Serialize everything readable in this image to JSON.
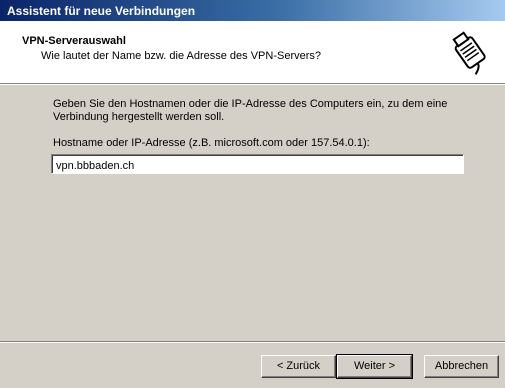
{
  "window": {
    "title": "Assistent für neue Verbindungen"
  },
  "header": {
    "title": "VPN-Serverauswahl",
    "subtitle": "Wie lautet der Name bzw. die Adresse des VPN-Servers?",
    "icon": "vpn-plug-icon"
  },
  "content": {
    "instruction": "Geben Sie den Hostnamen oder die IP-Adresse des Computers ein, zu dem eine Verbindung hergestellt werden soll.",
    "field_label": "Hostname oder IP-Adresse (z.B. microsoft.com oder 157.54.0.1):",
    "host_value": "vpn.bbbaden.ch"
  },
  "buttons": {
    "back": "< Zurück",
    "next": "Weiter >",
    "cancel": "Abbrechen"
  },
  "colors": {
    "title_start": "#0a246a",
    "title_end": "#a6caf0",
    "face": "#d4d0c8"
  }
}
